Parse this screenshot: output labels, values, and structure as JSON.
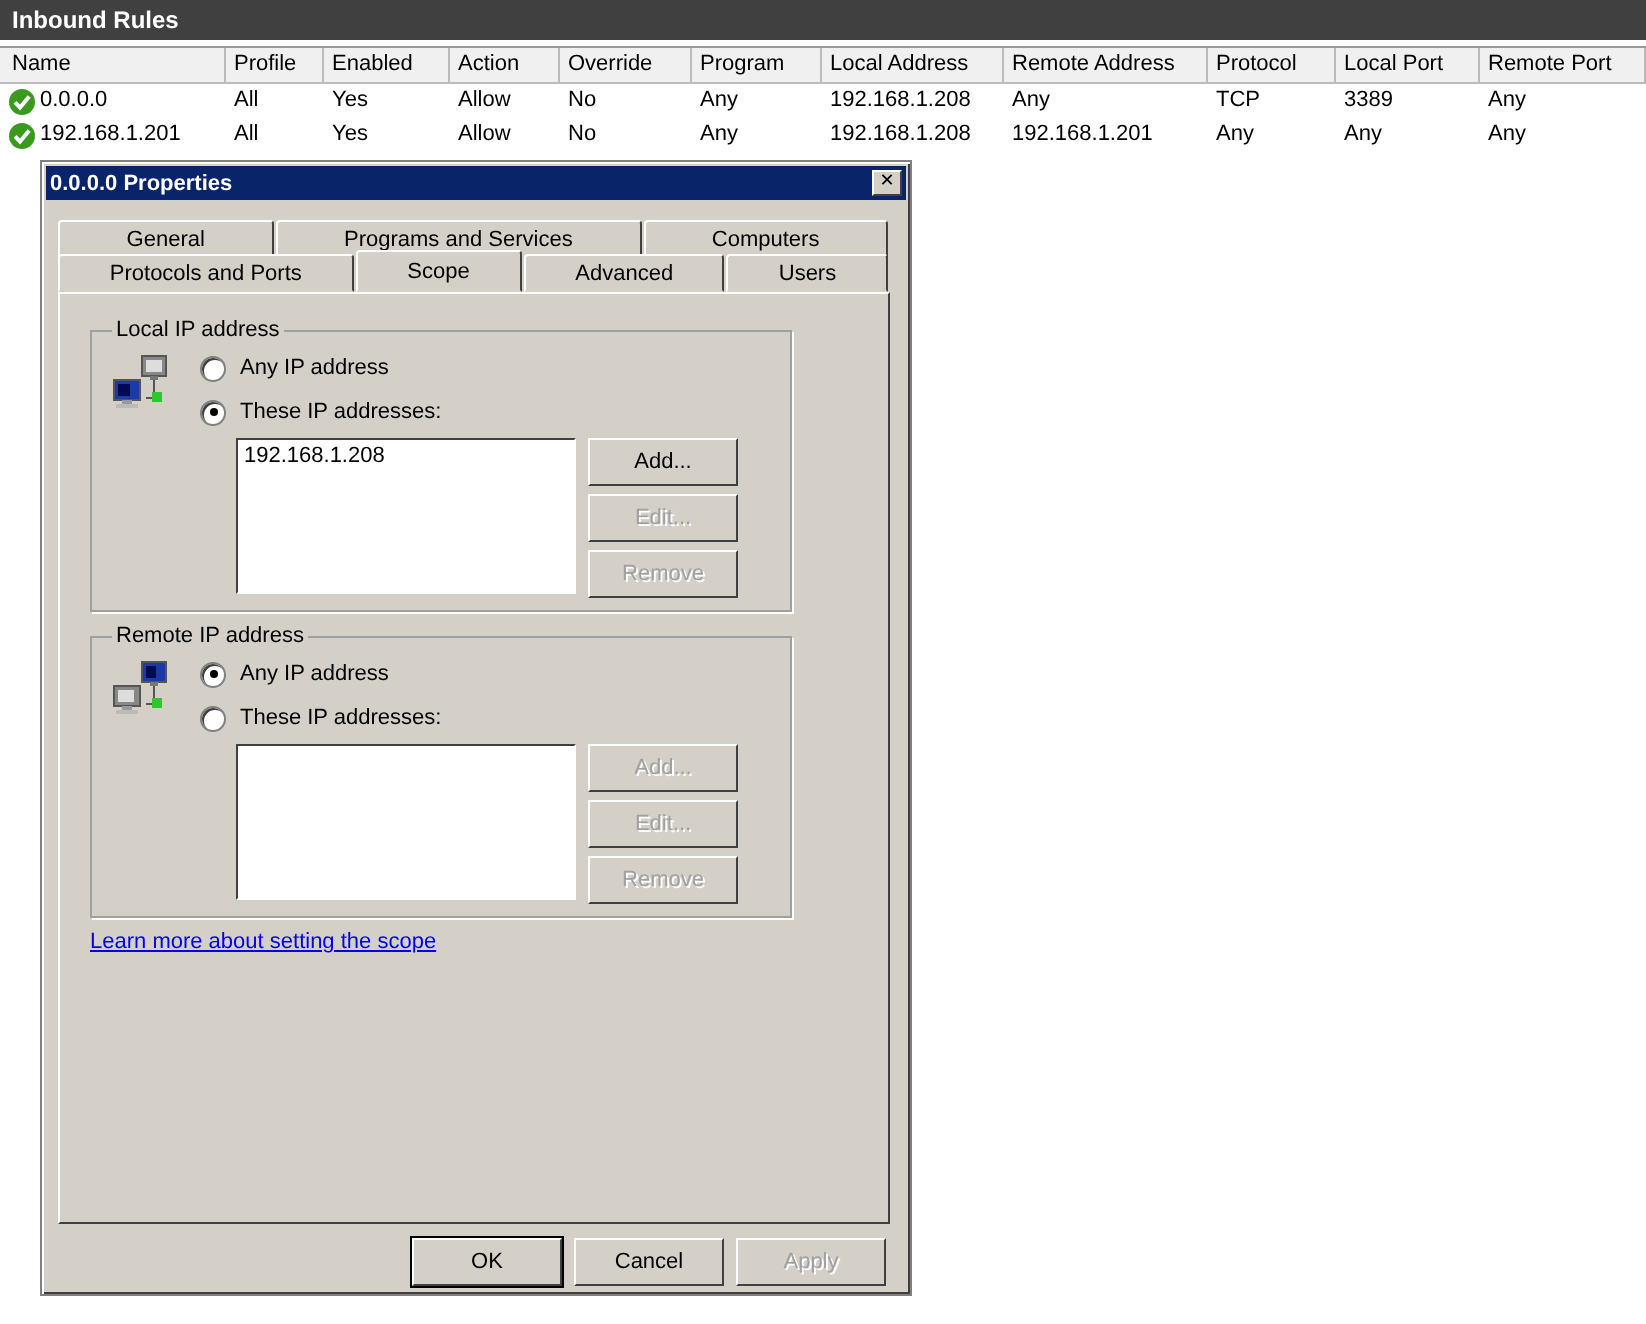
{
  "pane": {
    "title": "Inbound Rules"
  },
  "table": {
    "columns": [
      "Name",
      "Profile",
      "Enabled",
      "Action",
      "Override",
      "Program",
      "Local Address",
      "Remote Address",
      "Protocol",
      "Local Port",
      "Remote Port"
    ],
    "rows": [
      {
        "kind": "enabled",
        "cells": [
          "0.0.0.0",
          "All",
          "Yes",
          "Allow",
          "No",
          "Any",
          "192.168.1.208",
          "Any",
          "TCP",
          "3389",
          "Any"
        ]
      },
      {
        "kind": "enabled",
        "cells": [
          "192.168.1.201",
          "All",
          "Yes",
          "Allow",
          "No",
          "Any",
          "192.168.1.208",
          "192.168.1.201",
          "Any",
          "Any",
          "Any"
        ]
      }
    ]
  },
  "dialog": {
    "title": "0.0.0.0 Properties",
    "close": "✕",
    "tab_rows": [
      [
        {
          "label": "General",
          "selected": false
        },
        {
          "label": "Programs and Services",
          "selected": false
        },
        {
          "label": "Computers",
          "selected": false
        }
      ],
      [
        {
          "label": "Protocols and Ports",
          "selected": false
        },
        {
          "label": "Scope",
          "selected": true
        },
        {
          "label": "Advanced",
          "selected": false
        },
        {
          "label": "Users",
          "selected": false
        }
      ]
    ],
    "groups": [
      {
        "title": "Local IP address",
        "kind": "local",
        "options": [
          {
            "label": "Any IP address",
            "selected": false
          },
          {
            "label": "These IP addresses:",
            "selected": true
          }
        ],
        "addresses": [
          "192.168.1.208"
        ],
        "buttons": [
          {
            "label": "Add...",
            "disabled": false
          },
          {
            "label": "Edit...",
            "disabled": true
          },
          {
            "label": "Remove",
            "disabled": true
          }
        ]
      },
      {
        "title": "Remote IP address",
        "kind": "remote",
        "options": [
          {
            "label": "Any IP address",
            "selected": true
          },
          {
            "label": "These IP addresses:",
            "selected": false
          }
        ],
        "buttons": [
          {
            "label": "Add...",
            "disabled": true
          },
          {
            "label": "Edit...",
            "disabled": true
          },
          {
            "label": "Remove",
            "disabled": true
          }
        ]
      }
    ],
    "link": "Learn more about setting the scope",
    "footer_buttons": [
      {
        "label": "OK",
        "disabled": false,
        "default": true
      },
      {
        "label": "Cancel",
        "disabled": false,
        "default": false
      },
      {
        "label": "Apply",
        "disabled": true,
        "default": false
      }
    ]
  }
}
